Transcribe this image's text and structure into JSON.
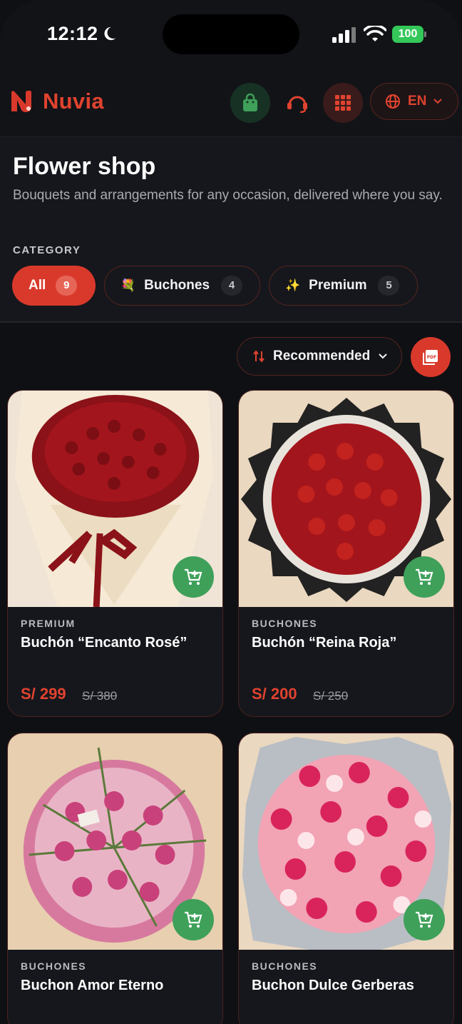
{
  "status_bar": {
    "time": "12:12",
    "battery": "100"
  },
  "brand": {
    "name": "Nuvia",
    "accent": "#e0432f"
  },
  "header": {
    "language": "EN"
  },
  "page": {
    "title": "Flower shop",
    "subtitle": "Bouquets and arrangements for any occasion, delivered where you say.",
    "category_label": "CATEGORY"
  },
  "categories": [
    {
      "label": "All",
      "count": "9",
      "emoji": "",
      "active": true
    },
    {
      "label": "Buchones",
      "count": "4",
      "emoji": "💐",
      "active": false
    },
    {
      "label": "Premium",
      "count": "5",
      "emoji": "✨",
      "active": false
    }
  ],
  "toolbar": {
    "sort_label": "Recommended"
  },
  "products": [
    {
      "category": "PREMIUM",
      "name": "Buchón “Encanto Rosé”",
      "price": "S/ 299",
      "old_price": "S/ 380"
    },
    {
      "category": "BUCHONES",
      "name": "Buchón “Reina Roja”",
      "price": "S/ 200",
      "old_price": "S/ 250"
    },
    {
      "category": "BUCHONES",
      "name": "Buchon Amor Eterno",
      "price": "",
      "old_price": ""
    },
    {
      "category": "BUCHONES",
      "name": "Buchon Dulce Gerberas",
      "price": "",
      "old_price": ""
    }
  ]
}
